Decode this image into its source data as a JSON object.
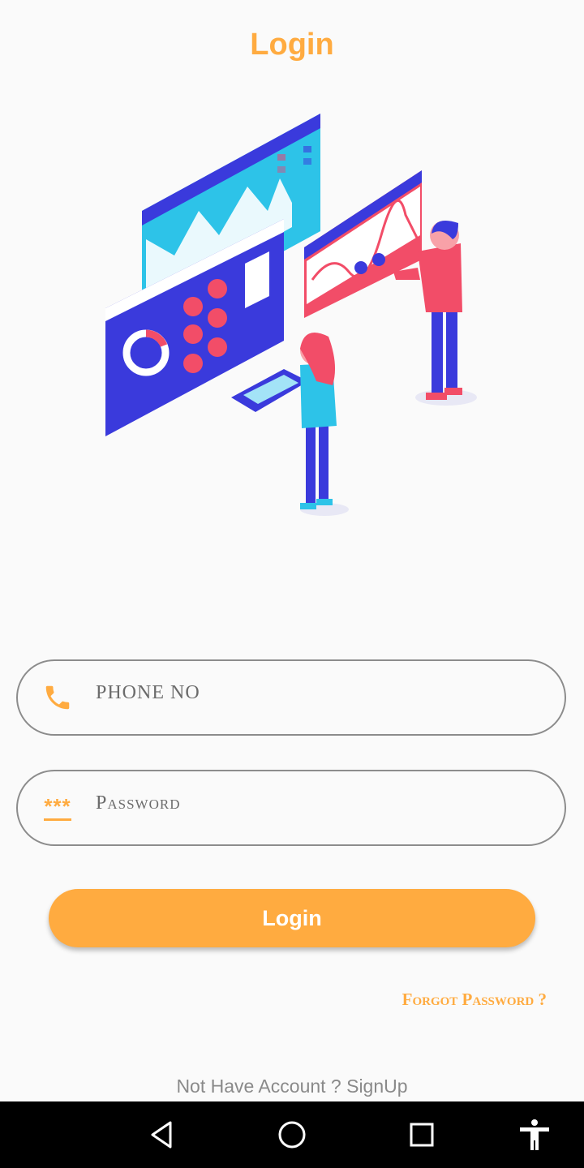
{
  "header": {
    "title": "Login"
  },
  "form": {
    "phone": {
      "placeholder": "PHONE NO",
      "icon": "phone-icon"
    },
    "password": {
      "placeholder": "Password",
      "icon_text": "***"
    },
    "login_label": "Login",
    "forgot_label": "Forgot Password ?"
  },
  "footer": {
    "signup_text": "Not Have Account ? SignUp"
  },
  "navbar": {
    "icons": [
      "back-icon",
      "home-icon",
      "recents-icon",
      "accessibility-icon"
    ]
  },
  "colors": {
    "accent": "#FFAB40",
    "background": "#fafafa",
    "border": "#8c8c8c",
    "navbar": "#000000"
  }
}
